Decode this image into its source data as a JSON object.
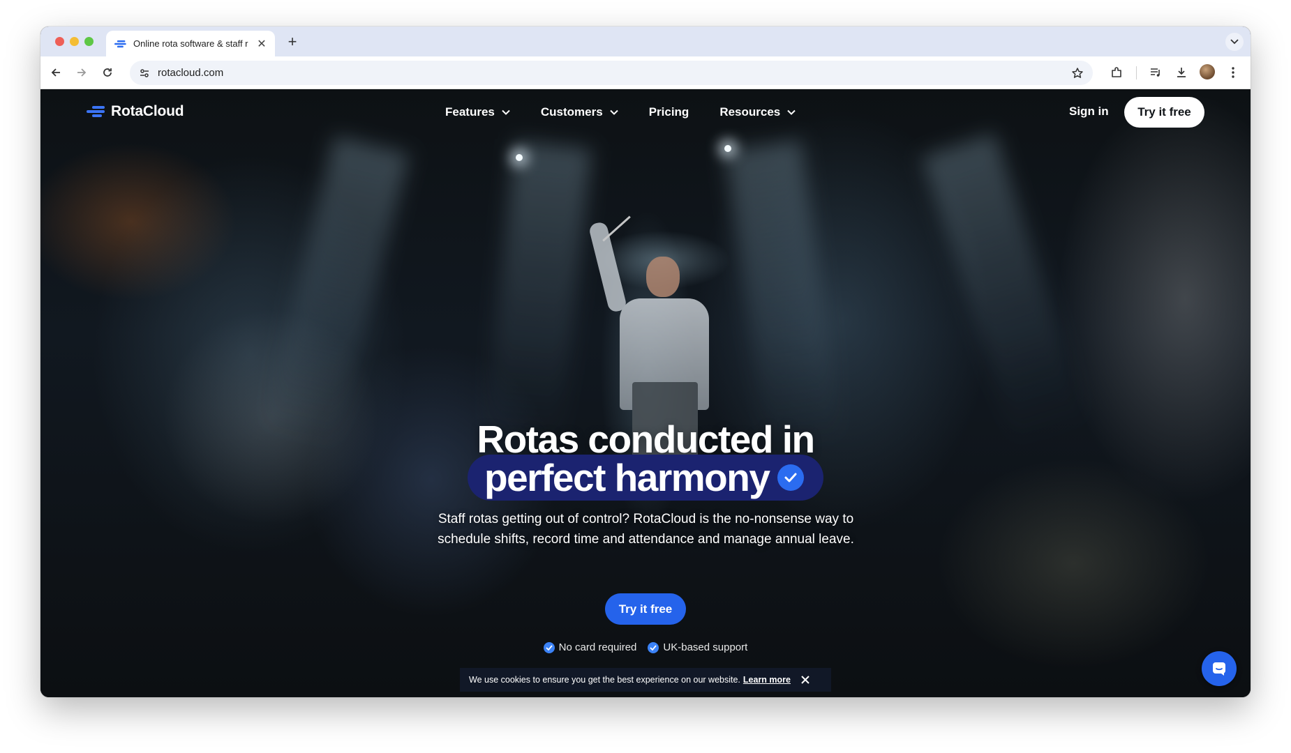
{
  "browser": {
    "tab_title": "Online rota software & staff r",
    "url": "rotacloud.com"
  },
  "site": {
    "logo_text": "RotaCloud",
    "nav": [
      "Features",
      "Customers",
      "Pricing",
      "Resources"
    ],
    "sign_in": "Sign in",
    "try_free_nav": "Try it free"
  },
  "hero": {
    "line1": "Rotas conducted in",
    "line2": "perfect harmony",
    "subtitle": "Staff rotas getting out of control? RotaCloud is the no-nonsense way to schedule shifts, record time and attendance and manage annual leave.",
    "cta": "Try it free",
    "badges": [
      "No card required",
      "UK-based support"
    ]
  },
  "cookie_banner": {
    "text": "We use cookies to ensure you get the best experience on our website.",
    "link": "Learn more"
  },
  "colors": {
    "brand_blue": "#2563eb",
    "pill_navy": "#1b2370"
  },
  "icons": [
    "back-arrow-icon",
    "forward-arrow-icon",
    "reload-icon",
    "site-settings-icon",
    "star-icon",
    "extensions-icon",
    "media-controls-icon",
    "download-icon",
    "more-vert-icon",
    "check-icon",
    "close-icon",
    "chat-icon"
  ]
}
